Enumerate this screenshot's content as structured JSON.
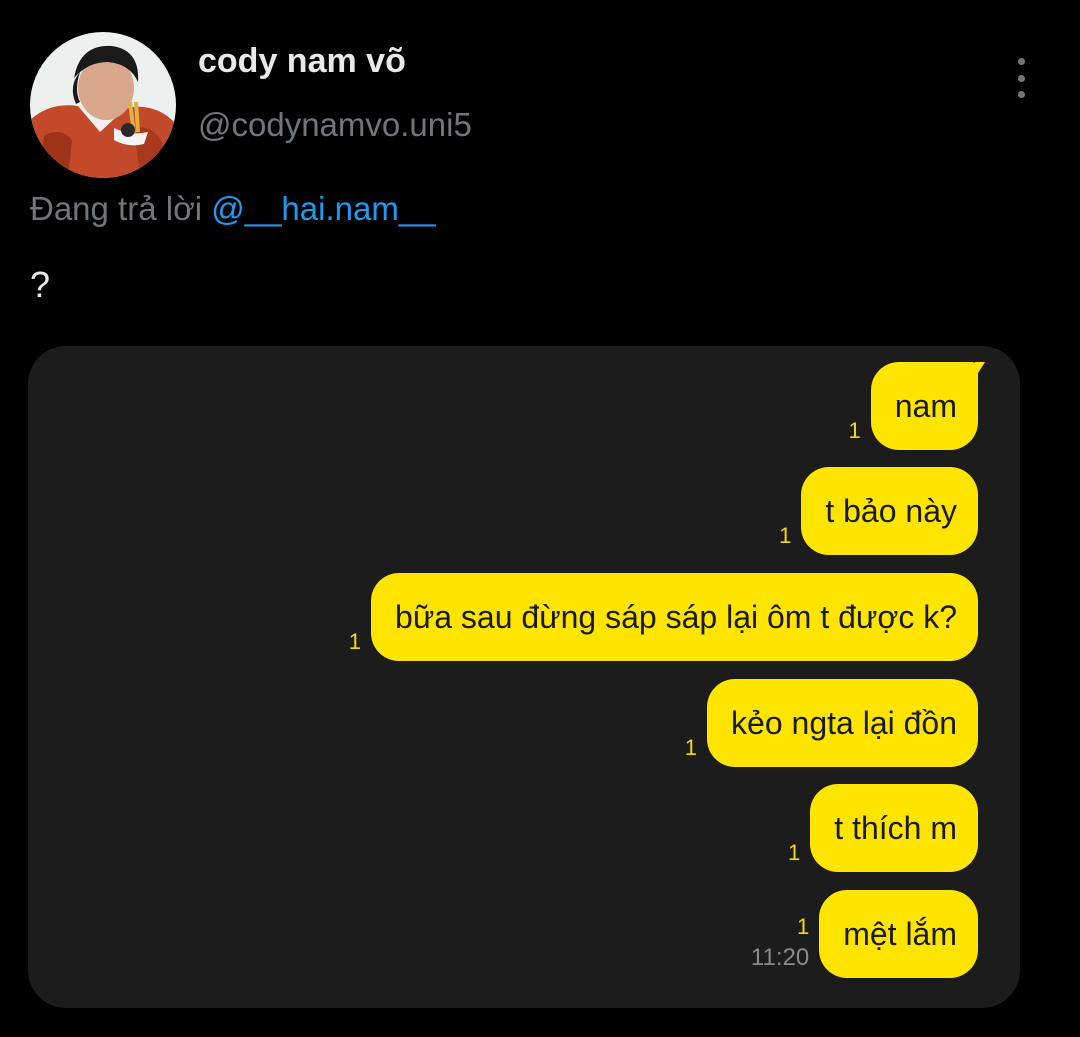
{
  "tweet": {
    "display_name": "cody nam võ",
    "handle": "@codynamvo.uni5",
    "replying_prefix": "Đang trả lời ",
    "replying_to": "@__hai.nam__",
    "text": "?"
  },
  "chat": {
    "messages": [
      {
        "text": "nam",
        "read_count": "1"
      },
      {
        "text": "t bảo này",
        "read_count": "1"
      },
      {
        "text": "bữa sau đừng sáp sáp lại ôm t được k?",
        "read_count": "1"
      },
      {
        "text": "kẻo ngta lại đồn",
        "read_count": "1"
      },
      {
        "text": "t thích m",
        "read_count": "1"
      },
      {
        "text": "mệt lắm",
        "read_count": "1",
        "time": "11:20"
      }
    ]
  },
  "colors": {
    "background": "#000000",
    "card": "#1c1c1c",
    "bubble": "#fee500",
    "mention": "#1d9bf0",
    "muted": "#71767b",
    "read_count": "#f5d90a"
  },
  "icons": {
    "more": "more-vertical-icon"
  }
}
